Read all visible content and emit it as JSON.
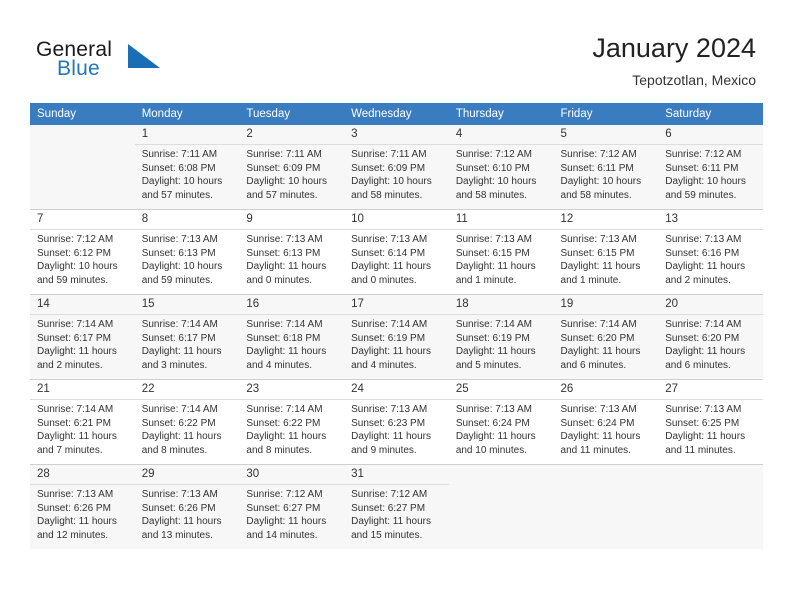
{
  "brand": {
    "word1": "General",
    "word2": "Blue",
    "logo_icon": "triangle-logo-icon",
    "accent_color": "#2277bb"
  },
  "header": {
    "title": "January 2024",
    "subtitle": "Tepotzotlan, Mexico"
  },
  "theme": {
    "header_row_bg": "#3a7cc0",
    "shaded_row_bg": "#f7f7f7",
    "text_color": "#333333"
  },
  "calendar": {
    "weekday_headers": [
      "Sunday",
      "Monday",
      "Tuesday",
      "Wednesday",
      "Thursday",
      "Friday",
      "Saturday"
    ],
    "weeks": [
      [
        {
          "day": "",
          "lines": []
        },
        {
          "day": "1",
          "lines": [
            "Sunrise: 7:11 AM",
            "Sunset: 6:08 PM",
            "Daylight: 10 hours",
            "and 57 minutes."
          ]
        },
        {
          "day": "2",
          "lines": [
            "Sunrise: 7:11 AM",
            "Sunset: 6:09 PM",
            "Daylight: 10 hours",
            "and 57 minutes."
          ]
        },
        {
          "day": "3",
          "lines": [
            "Sunrise: 7:11 AM",
            "Sunset: 6:09 PM",
            "Daylight: 10 hours",
            "and 58 minutes."
          ]
        },
        {
          "day": "4",
          "lines": [
            "Sunrise: 7:12 AM",
            "Sunset: 6:10 PM",
            "Daylight: 10 hours",
            "and 58 minutes."
          ]
        },
        {
          "day": "5",
          "lines": [
            "Sunrise: 7:12 AM",
            "Sunset: 6:11 PM",
            "Daylight: 10 hours",
            "and 58 minutes."
          ]
        },
        {
          "day": "6",
          "lines": [
            "Sunrise: 7:12 AM",
            "Sunset: 6:11 PM",
            "Daylight: 10 hours",
            "and 59 minutes."
          ]
        }
      ],
      [
        {
          "day": "7",
          "lines": [
            "Sunrise: 7:12 AM",
            "Sunset: 6:12 PM",
            "Daylight: 10 hours",
            "and 59 minutes."
          ]
        },
        {
          "day": "8",
          "lines": [
            "Sunrise: 7:13 AM",
            "Sunset: 6:13 PM",
            "Daylight: 10 hours",
            "and 59 minutes."
          ]
        },
        {
          "day": "9",
          "lines": [
            "Sunrise: 7:13 AM",
            "Sunset: 6:13 PM",
            "Daylight: 11 hours",
            "and 0 minutes."
          ]
        },
        {
          "day": "10",
          "lines": [
            "Sunrise: 7:13 AM",
            "Sunset: 6:14 PM",
            "Daylight: 11 hours",
            "and 0 minutes."
          ]
        },
        {
          "day": "11",
          "lines": [
            "Sunrise: 7:13 AM",
            "Sunset: 6:15 PM",
            "Daylight: 11 hours",
            "and 1 minute."
          ]
        },
        {
          "day": "12",
          "lines": [
            "Sunrise: 7:13 AM",
            "Sunset: 6:15 PM",
            "Daylight: 11 hours",
            "and 1 minute."
          ]
        },
        {
          "day": "13",
          "lines": [
            "Sunrise: 7:13 AM",
            "Sunset: 6:16 PM",
            "Daylight: 11 hours",
            "and 2 minutes."
          ]
        }
      ],
      [
        {
          "day": "14",
          "lines": [
            "Sunrise: 7:14 AM",
            "Sunset: 6:17 PM",
            "Daylight: 11 hours",
            "and 2 minutes."
          ]
        },
        {
          "day": "15",
          "lines": [
            "Sunrise: 7:14 AM",
            "Sunset: 6:17 PM",
            "Daylight: 11 hours",
            "and 3 minutes."
          ]
        },
        {
          "day": "16",
          "lines": [
            "Sunrise: 7:14 AM",
            "Sunset: 6:18 PM",
            "Daylight: 11 hours",
            "and 4 minutes."
          ]
        },
        {
          "day": "17",
          "lines": [
            "Sunrise: 7:14 AM",
            "Sunset: 6:19 PM",
            "Daylight: 11 hours",
            "and 4 minutes."
          ]
        },
        {
          "day": "18",
          "lines": [
            "Sunrise: 7:14 AM",
            "Sunset: 6:19 PM",
            "Daylight: 11 hours",
            "and 5 minutes."
          ]
        },
        {
          "day": "19",
          "lines": [
            "Sunrise: 7:14 AM",
            "Sunset: 6:20 PM",
            "Daylight: 11 hours",
            "and 6 minutes."
          ]
        },
        {
          "day": "20",
          "lines": [
            "Sunrise: 7:14 AM",
            "Sunset: 6:20 PM",
            "Daylight: 11 hours",
            "and 6 minutes."
          ]
        }
      ],
      [
        {
          "day": "21",
          "lines": [
            "Sunrise: 7:14 AM",
            "Sunset: 6:21 PM",
            "Daylight: 11 hours",
            "and 7 minutes."
          ]
        },
        {
          "day": "22",
          "lines": [
            "Sunrise: 7:14 AM",
            "Sunset: 6:22 PM",
            "Daylight: 11 hours",
            "and 8 minutes."
          ]
        },
        {
          "day": "23",
          "lines": [
            "Sunrise: 7:14 AM",
            "Sunset: 6:22 PM",
            "Daylight: 11 hours",
            "and 8 minutes."
          ]
        },
        {
          "day": "24",
          "lines": [
            "Sunrise: 7:13 AM",
            "Sunset: 6:23 PM",
            "Daylight: 11 hours",
            "and 9 minutes."
          ]
        },
        {
          "day": "25",
          "lines": [
            "Sunrise: 7:13 AM",
            "Sunset: 6:24 PM",
            "Daylight: 11 hours",
            "and 10 minutes."
          ]
        },
        {
          "day": "26",
          "lines": [
            "Sunrise: 7:13 AM",
            "Sunset: 6:24 PM",
            "Daylight: 11 hours",
            "and 11 minutes."
          ]
        },
        {
          "day": "27",
          "lines": [
            "Sunrise: 7:13 AM",
            "Sunset: 6:25 PM",
            "Daylight: 11 hours",
            "and 11 minutes."
          ]
        }
      ],
      [
        {
          "day": "28",
          "lines": [
            "Sunrise: 7:13 AM",
            "Sunset: 6:26 PM",
            "Daylight: 11 hours",
            "and 12 minutes."
          ]
        },
        {
          "day": "29",
          "lines": [
            "Sunrise: 7:13 AM",
            "Sunset: 6:26 PM",
            "Daylight: 11 hours",
            "and 13 minutes."
          ]
        },
        {
          "day": "30",
          "lines": [
            "Sunrise: 7:12 AM",
            "Sunset: 6:27 PM",
            "Daylight: 11 hours",
            "and 14 minutes."
          ]
        },
        {
          "day": "31",
          "lines": [
            "Sunrise: 7:12 AM",
            "Sunset: 6:27 PM",
            "Daylight: 11 hours",
            "and 15 minutes."
          ]
        },
        {
          "day": "",
          "lines": []
        },
        {
          "day": "",
          "lines": []
        },
        {
          "day": "",
          "lines": []
        }
      ]
    ]
  }
}
